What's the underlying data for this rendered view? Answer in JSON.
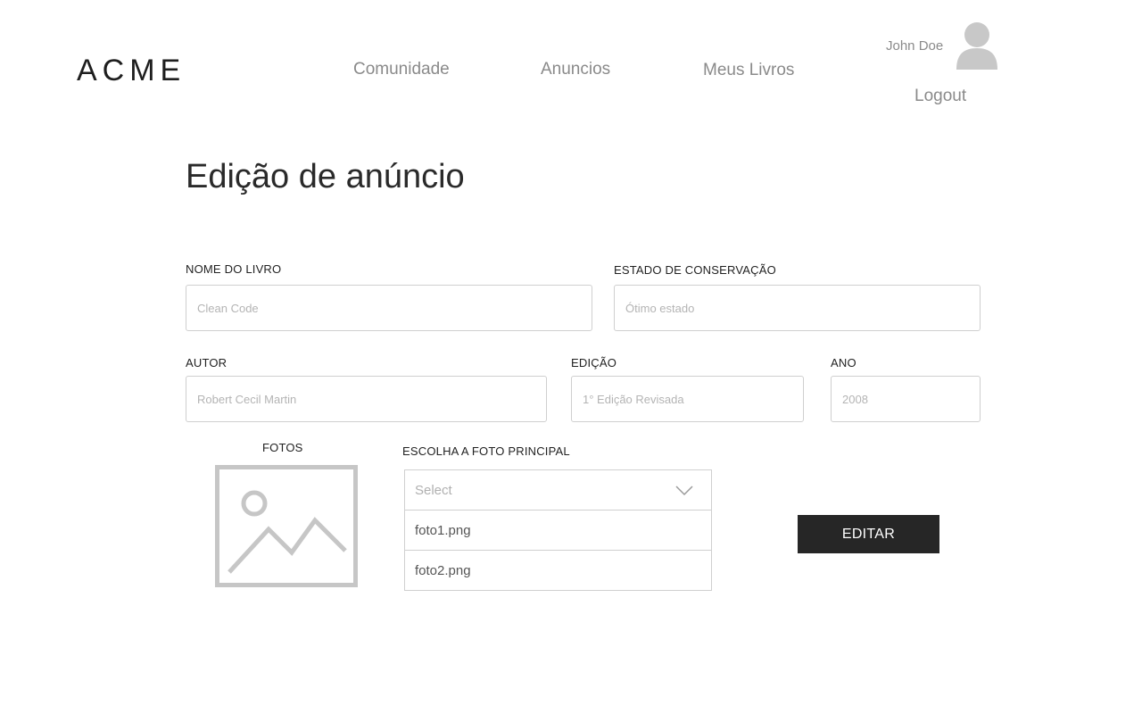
{
  "header": {
    "logo": "ACME",
    "nav": [
      {
        "label": "Comunidade"
      },
      {
        "label": "Anuncios"
      },
      {
        "label": "Meus Livros"
      }
    ],
    "user": {
      "name": "John Doe",
      "avatar_icon": "user-avatar-icon",
      "logout_label": "Logout"
    }
  },
  "page": {
    "title": "Edição de anúncio"
  },
  "form": {
    "nome": {
      "label": "NOME DO LIVRO",
      "placeholder": "Clean Code"
    },
    "estado": {
      "label": "ESTADO DE CONSERVAÇÃO",
      "placeholder": "Ótimo estado"
    },
    "autor": {
      "label": "AUTOR",
      "placeholder": "Robert Cecil Martin"
    },
    "edicao": {
      "label": "EDIÇÃO",
      "placeholder": "1° Edição Revisada"
    },
    "ano": {
      "label": "ANO",
      "placeholder": "2008"
    },
    "fotos": {
      "label": "FOTOS",
      "icon": "image-placeholder-icon"
    },
    "foto_principal": {
      "label": "ESCOLHA A FOTO PRINCIPAL",
      "placeholder": "Select",
      "options": [
        "foto1.png",
        "foto2.png"
      ]
    },
    "submit_label": "EDITAR"
  },
  "colors": {
    "button_bg": "#262626",
    "nav_text": "#8a8a8a",
    "border": "#cfcfcf",
    "placeholder": "#b4b4b4"
  }
}
